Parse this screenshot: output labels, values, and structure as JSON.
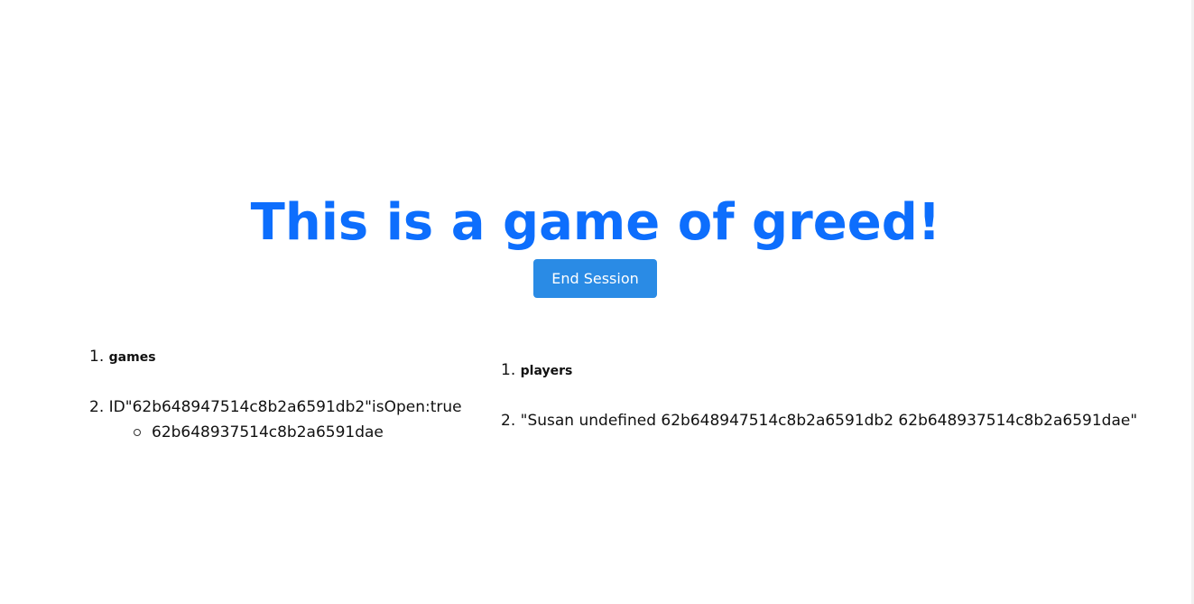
{
  "header": {
    "title": "This is a game of greed!",
    "end_session_label": "End Session"
  },
  "games_list": {
    "items": [
      {
        "number": "1.",
        "label": "games"
      },
      {
        "number": "2.",
        "label": "ID\"62b648947514c8b2a6591db2\"isOpen:true"
      }
    ],
    "sub_items": [
      "62b648937514c8b2a6591dae"
    ]
  },
  "players_list": {
    "items": [
      {
        "number": "1.",
        "label": "players"
      },
      {
        "number": "2.",
        "label": "\"Susan undefined 62b648947514c8b2a6591db2 62b648937514c8b2a6591dae\""
      }
    ]
  },
  "colors": {
    "title": "#0d6efd",
    "button": "#2a8be5"
  }
}
